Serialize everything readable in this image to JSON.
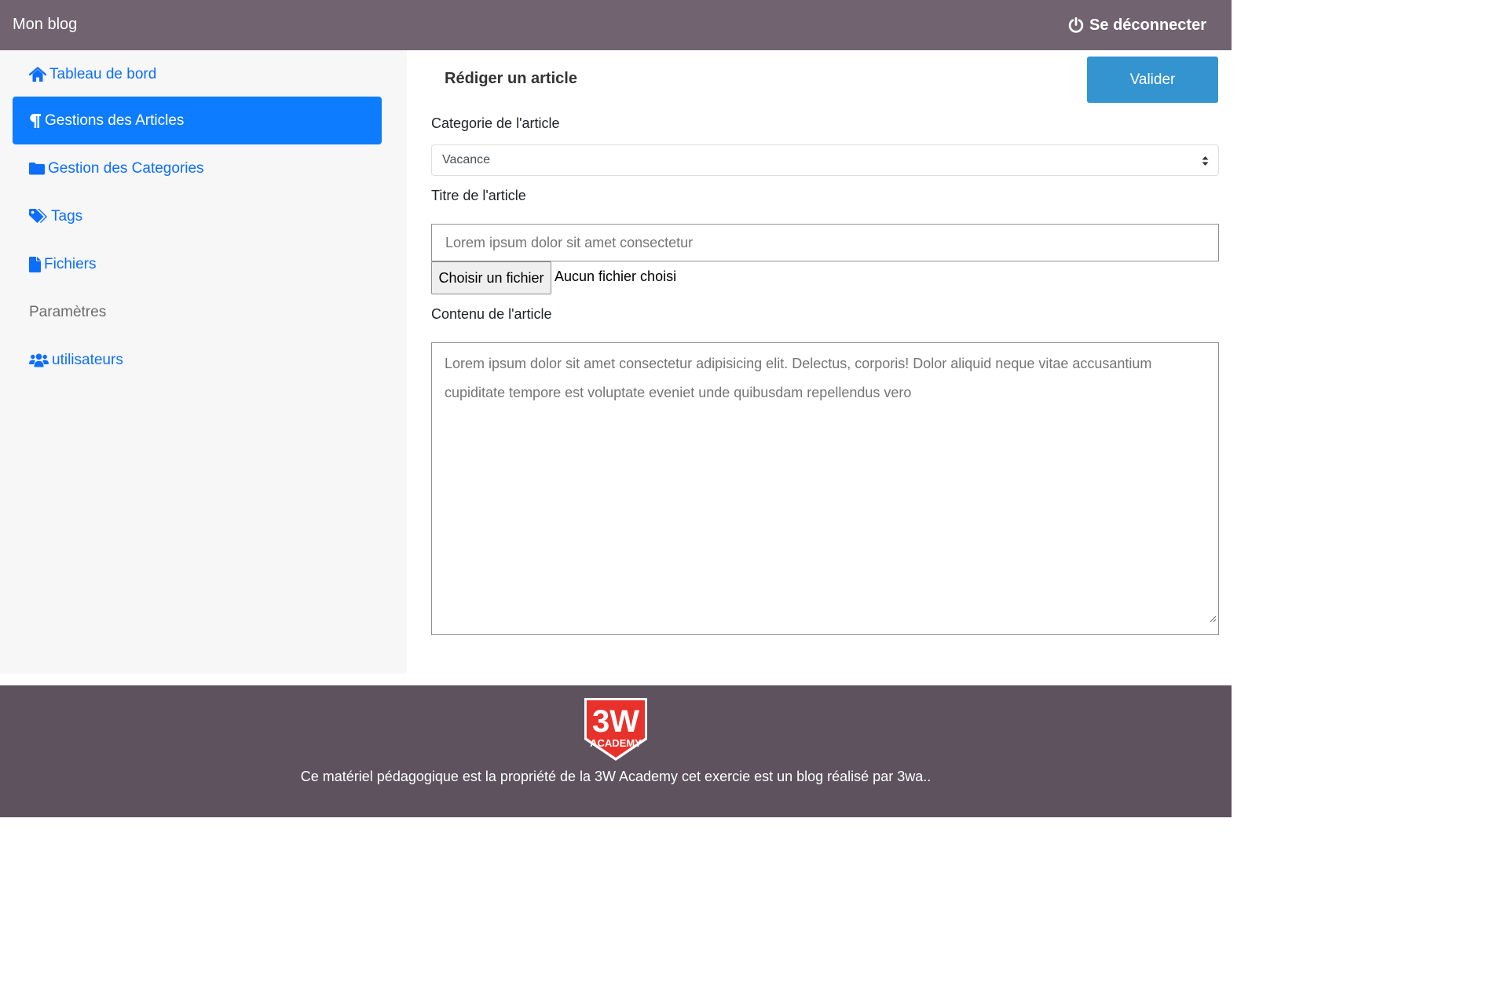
{
  "header": {
    "brand": "Mon blog",
    "logout_label": "Se déconnecter",
    "logout_icon": "power-icon"
  },
  "sidebar": {
    "items": [
      {
        "label": "Tableau de bord",
        "icon": "home-icon",
        "active": false
      },
      {
        "label": "Gestions des Articles",
        "icon": "paragraph-icon",
        "active": true
      },
      {
        "label": "Gestion des Categories",
        "icon": "folder-icon",
        "active": false
      },
      {
        "label": "Tags",
        "icon": "tags-icon",
        "active": false
      },
      {
        "label": "Fichiers",
        "icon": "file-icon",
        "active": false
      },
      {
        "label": "Paramètres",
        "icon": "",
        "active": false
      },
      {
        "label": "utilisateurs",
        "icon": "users-icon",
        "active": false
      }
    ]
  },
  "main": {
    "title": "Rédiger un article",
    "submit_label": "Valider",
    "category_label": "Categorie de l'article",
    "category_value": "Vacance",
    "title_label": "Titre de l'article",
    "title_placeholder": "Lorem ipsum dolor sit amet consectetur",
    "file_button_label": "Choisir un fichier",
    "file_status": "Aucun fichier choisi",
    "content_label": "Contenu de l'article",
    "content_placeholder": "Lorem ipsum dolor sit amet consectetur adipisicing elit. Delectus, corporis! Dolor aliquid neque vitae accusantium cupiditate tempore est voluptate eveniet unde quibusdam repellendus vero"
  },
  "footer": {
    "logo_text_main": "3W",
    "logo_text_sub": "ACADEMY",
    "text": "Ce matériel pédagogique est la propriété de la 3W Academy cet exercie est un blog réalisé par 3wa.."
  },
  "colors": {
    "header_bg": "#726370",
    "footer_bg": "#5d525e",
    "accent": "#0d7cfe",
    "link": "#0d6efd",
    "submit_bg": "#3394cf",
    "logo_red": "#e8312b"
  }
}
